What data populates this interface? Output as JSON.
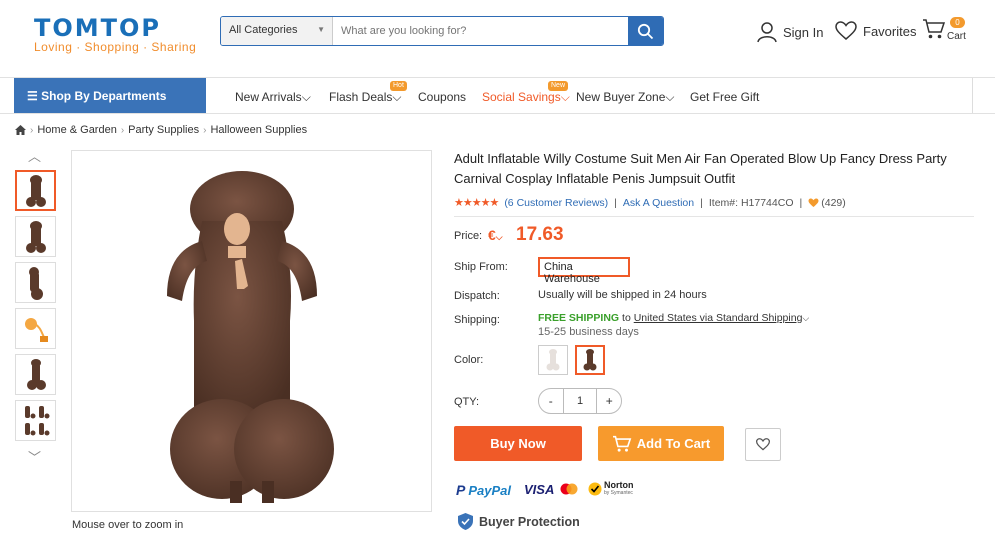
{
  "header": {
    "logo": "TOMTOP",
    "tagline": "Loving · Shopping · Sharing",
    "search_category": "All Categories",
    "search_placeholder": "What are you looking for?",
    "sign_in": "Sign In",
    "favorites": "Favorites",
    "cart_count": "0",
    "cart_label": "Cart"
  },
  "nav": {
    "departments": "Shop By Departments",
    "items": [
      "New Arrivals",
      "Flash Deals",
      "Coupons",
      "Social Savings",
      "New Buyer Zone",
      "Get Free Gift"
    ],
    "hot_tag": "Hot",
    "new_tag": "New"
  },
  "breadcrumb": [
    "Home & Garden",
    "Party Supplies",
    "Halloween Supplies"
  ],
  "gallery": {
    "zoom_note": "Mouse over to zoom in"
  },
  "product": {
    "title": "Adult Inflatable Willy Costume Suit Men Air Fan Operated Blow Up Fancy Dress Party Carnival Cosplay Inflatable Penis Jumpsuit Outfit",
    "reviews": "(6 Customer Reviews)",
    "ask": "Ask A Question",
    "item_no": "Item#: H17744CO",
    "likes": "(429)",
    "price_label": "Price:",
    "currency": "€",
    "price": "17.63",
    "ship_from_label": "Ship From:",
    "ship_from": "China Warehouse",
    "dispatch_label": "Dispatch:",
    "dispatch": "Usually will be shipped in 24 hours",
    "shipping_label": "Shipping:",
    "free_shipping": "FREE SHIPPING",
    "shipping_to": "to",
    "shipping_method": "United States via Standard Shipping",
    "shipping_days": "15-25 business days",
    "color_label": "Color:",
    "qty_label": "QTY:",
    "qty_minus": "-",
    "qty_value": "1",
    "qty_plus": "+",
    "buy_now": "Buy Now",
    "add_to_cart": "Add To Cart",
    "paypal": "PayPal",
    "visa": "VISA",
    "norton": "Norton",
    "norton_sub": "by Symantec",
    "buyer_protection": "Buyer Protection"
  },
  "colors": {
    "brand_blue": "#2f6cb5",
    "accent_orange": "#f05a28",
    "costume_brown": "#5a3a2b"
  }
}
